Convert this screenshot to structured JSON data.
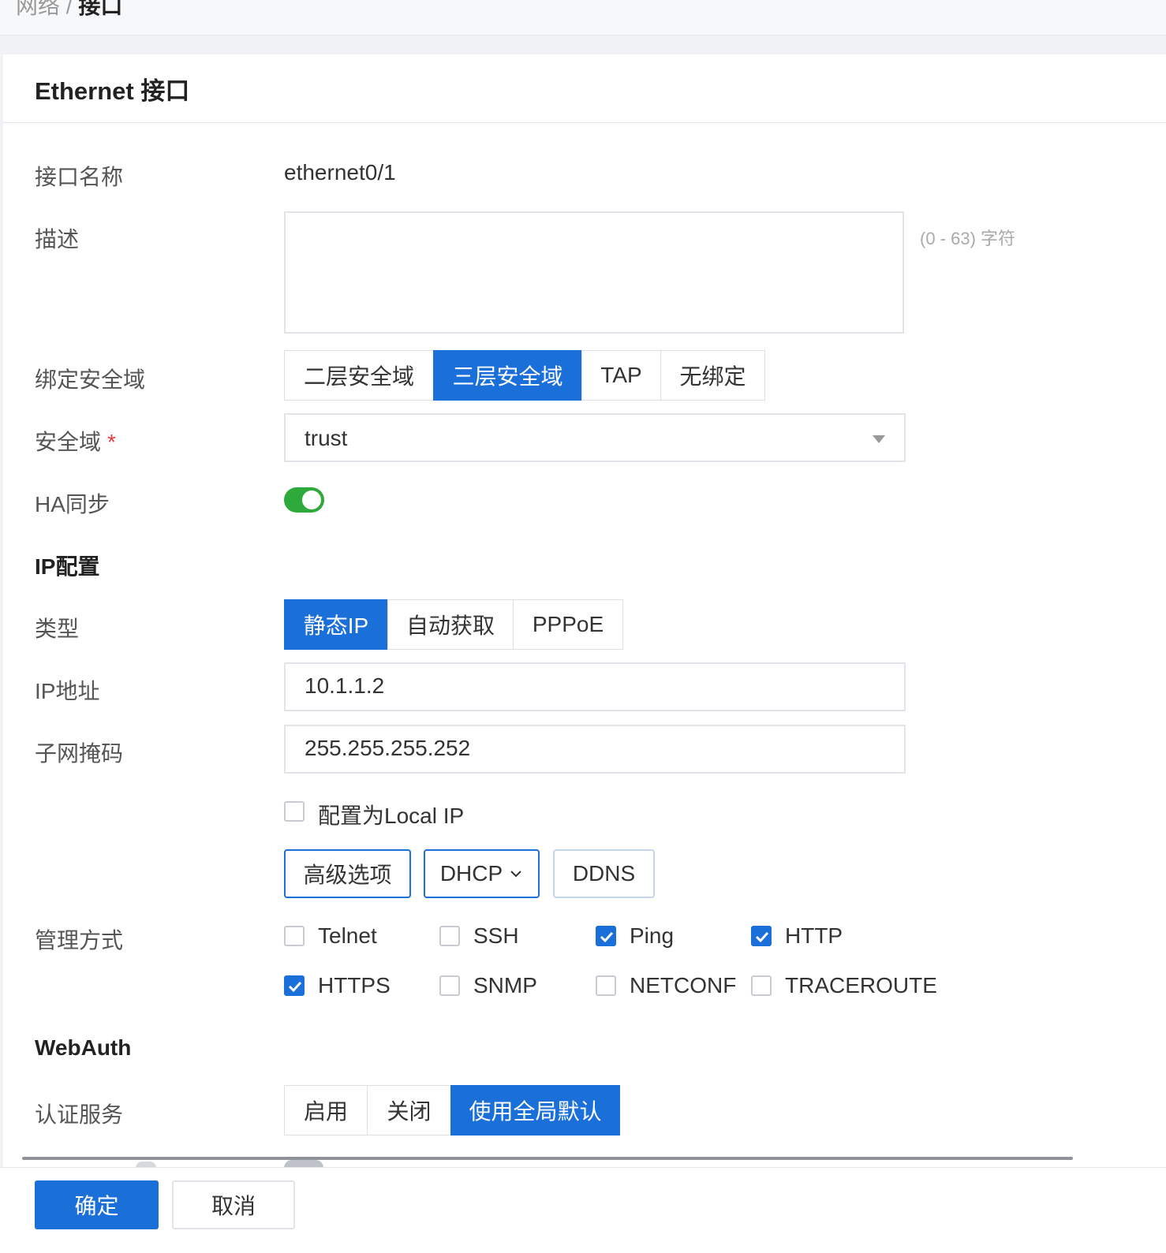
{
  "breadcrumb": {
    "parent": "网络 /",
    "current": "接口"
  },
  "panel": {
    "title": "Ethernet 接口"
  },
  "form": {
    "name_label": "接口名称",
    "name_value": "ethernet0/1",
    "desc_label": "描述",
    "desc_value": "",
    "desc_hint": "(0 - 63) 字符",
    "zone_bind_label": "绑定安全域",
    "zone_bind_options": [
      "二层安全域",
      "三层安全域",
      "TAP",
      "无绑定"
    ],
    "zone_bind_selected": "三层安全域",
    "zone_label": "安全域",
    "zone_required": "*",
    "zone_value": "trust",
    "ha_label": "HA同步",
    "ha_enabled": true
  },
  "ip": {
    "section": "IP配置",
    "type_label": "类型",
    "type_options": [
      "静态IP",
      "自动获取",
      "PPPoE"
    ],
    "type_selected": "静态IP",
    "addr_label": "IP地址",
    "addr_value": "10.1.1.2",
    "mask_label": "子网掩码",
    "mask_value": "255.255.255.252",
    "local_ip_label": "配置为Local IP",
    "local_ip_checked": false,
    "advanced_button": "高级选项",
    "dhcp_button": "DHCP",
    "ddns_button": "DDNS"
  },
  "mgmt": {
    "label": "管理方式",
    "items": [
      {
        "label": "Telnet",
        "checked": false
      },
      {
        "label": "SSH",
        "checked": false
      },
      {
        "label": "Ping",
        "checked": true
      },
      {
        "label": "HTTP",
        "checked": true
      },
      {
        "label": "HTTPS",
        "checked": true
      },
      {
        "label": "SNMP",
        "checked": false
      },
      {
        "label": "NETCONF",
        "checked": false
      },
      {
        "label": "TRACEROUTE",
        "checked": false
      }
    ]
  },
  "webauth": {
    "section": "WebAuth",
    "service_label": "认证服务",
    "options": [
      "启用",
      "关闭",
      "使用全局默认"
    ],
    "selected": "使用全局默认"
  },
  "footer": {
    "ok": "确定",
    "cancel": "取消"
  },
  "colors": {
    "primary": "#1b6fd8",
    "toggle_on": "#2eaa3a",
    "required": "#e6393a"
  }
}
